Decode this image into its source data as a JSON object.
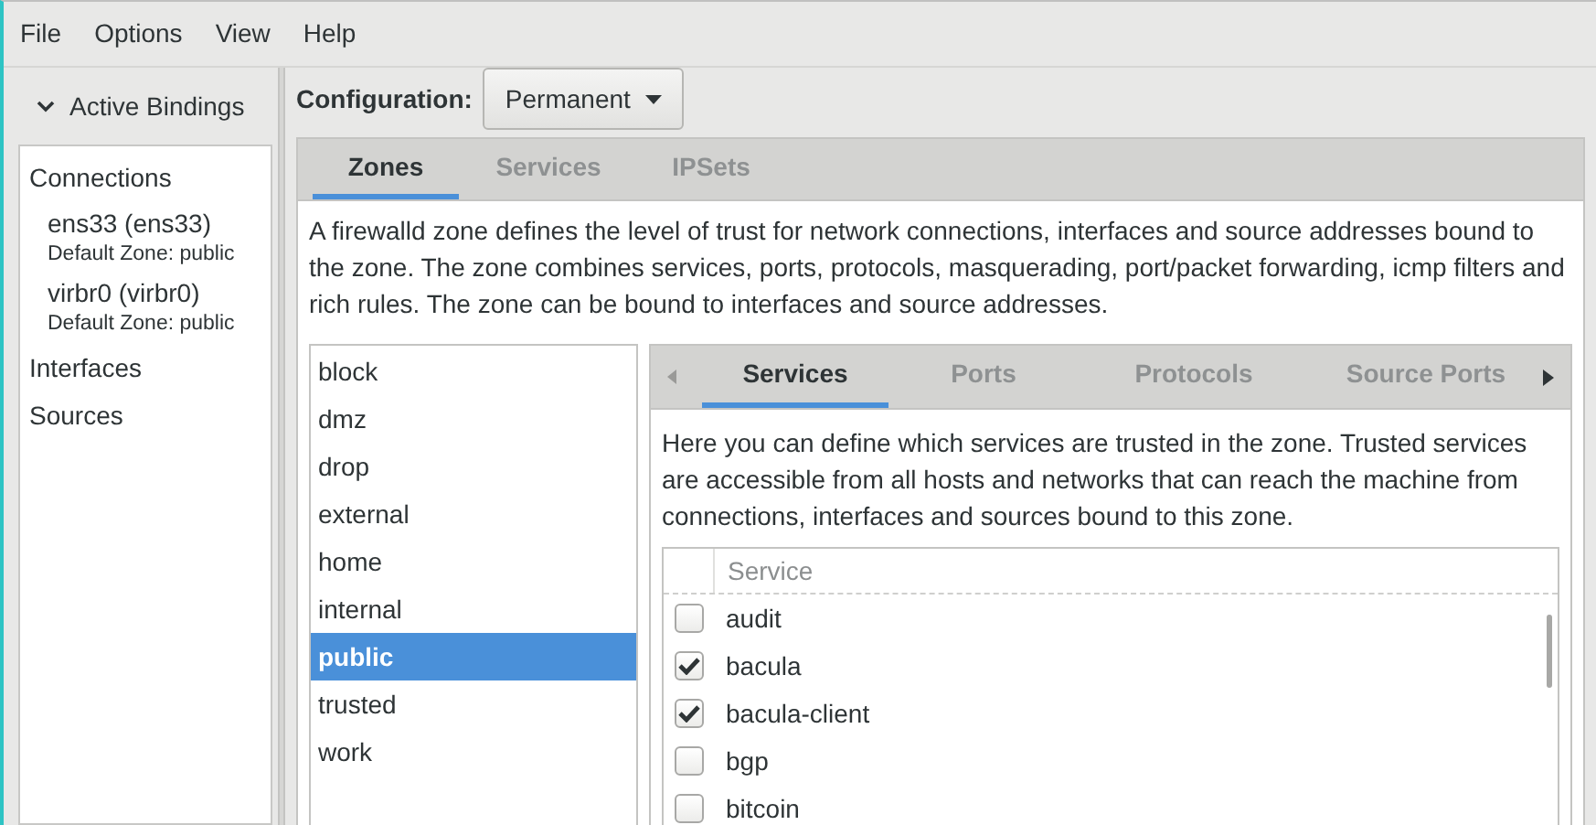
{
  "menu": [
    "File",
    "Options",
    "View",
    "Help"
  ],
  "bindings": {
    "title": "Active Bindings",
    "expanded": true,
    "sections": [
      {
        "label": "Connections",
        "children": [
          {
            "name": "ens33 (ens33)",
            "detail": "Default Zone: public"
          },
          {
            "name": "virbr0 (virbr0)",
            "detail": "Default Zone: public"
          }
        ]
      },
      {
        "label": "Interfaces"
      },
      {
        "label": "Sources"
      }
    ]
  },
  "configuration": {
    "label": "Configuration:",
    "value": "Permanent"
  },
  "tabs": [
    {
      "label": "Zones",
      "selected": true
    },
    {
      "label": "Services",
      "selected": false
    },
    {
      "label": "IPSets",
      "selected": false
    }
  ],
  "zone_description": "A firewalld zone defines the level of trust for network connections, interfaces and source addresses bound to the zone. The zone combines services, ports, protocols, masquerading, port/packet forwarding, icmp filters and rich rules. The zone can be bound to interfaces and source addresses.",
  "zones": [
    {
      "label": "block",
      "selected": false
    },
    {
      "label": "dmz",
      "selected": false
    },
    {
      "label": "drop",
      "selected": false
    },
    {
      "label": "external",
      "selected": false
    },
    {
      "label": "home",
      "selected": false
    },
    {
      "label": "internal",
      "selected": false
    },
    {
      "label": "public",
      "selected": true
    },
    {
      "label": "trusted",
      "selected": false
    },
    {
      "label": "work",
      "selected": false
    }
  ],
  "zone_tabs": [
    {
      "label": "Services",
      "selected": true
    },
    {
      "label": "Ports",
      "selected": false
    },
    {
      "label": "Protocols",
      "selected": false
    },
    {
      "label": "Source Ports",
      "selected": false
    }
  ],
  "services_description": "Here you can define which services are trusted in the zone. Trusted services are accessible from all hosts and networks that can reach the machine from connections, interfaces and sources bound to this zone.",
  "services_table": {
    "columns": [
      "Service"
    ],
    "rows": [
      {
        "name": "audit",
        "checked": false
      },
      {
        "name": "bacula",
        "checked": true
      },
      {
        "name": "bacula-client",
        "checked": true
      },
      {
        "name": "bgp",
        "checked": false
      },
      {
        "name": "bitcoin",
        "checked": false
      }
    ]
  }
}
